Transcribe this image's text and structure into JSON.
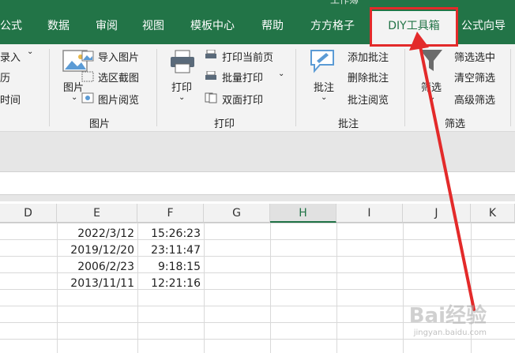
{
  "window": {
    "title": "工作簿"
  },
  "tabs": [
    {
      "label": "公式"
    },
    {
      "label": "数据"
    },
    {
      "label": "审阅"
    },
    {
      "label": "视图"
    },
    {
      "label": "模板中心"
    },
    {
      "label": "帮助"
    },
    {
      "label": "方方格子"
    },
    {
      "label": "DIY工具箱"
    },
    {
      "label": "公式向导"
    }
  ],
  "ribbon": {
    "left_partial": {
      "a": "录入",
      "b": "历",
      "c": "时间"
    },
    "picture": {
      "big": "图片",
      "items": [
        "导入图片",
        "选区截图",
        "图片阅览"
      ],
      "group": "图片"
    },
    "print": {
      "big": "打印",
      "items": [
        "打印当前页",
        "批量打印",
        "双面打印"
      ],
      "group": "打印"
    },
    "comment": {
      "big": "批注",
      "items": [
        "添加批注",
        "删除批注",
        "批注阅览"
      ],
      "group": "批注"
    },
    "filter": {
      "big": "筛选",
      "items": [
        "筛选选中",
        "清空筛选",
        "高级筛选"
      ],
      "group": "筛选"
    }
  },
  "columns": [
    "D",
    "E",
    "F",
    "G",
    "H",
    "I",
    "J",
    "K"
  ],
  "rows": [
    {
      "date": "2022/3/12",
      "time": "15:26:23"
    },
    {
      "date": "2019/12/20",
      "time": "23:11:47"
    },
    {
      "date": "2006/2/23",
      "time": "9:18:15"
    },
    {
      "date": "2013/11/11",
      "time": "12:21:16"
    }
  ],
  "watermark": {
    "brand": "Bai经验",
    "url": "jingyan.baidu.com"
  },
  "colors": {
    "excel_green": "#227447",
    "highlight_red": "#e32a2a"
  }
}
